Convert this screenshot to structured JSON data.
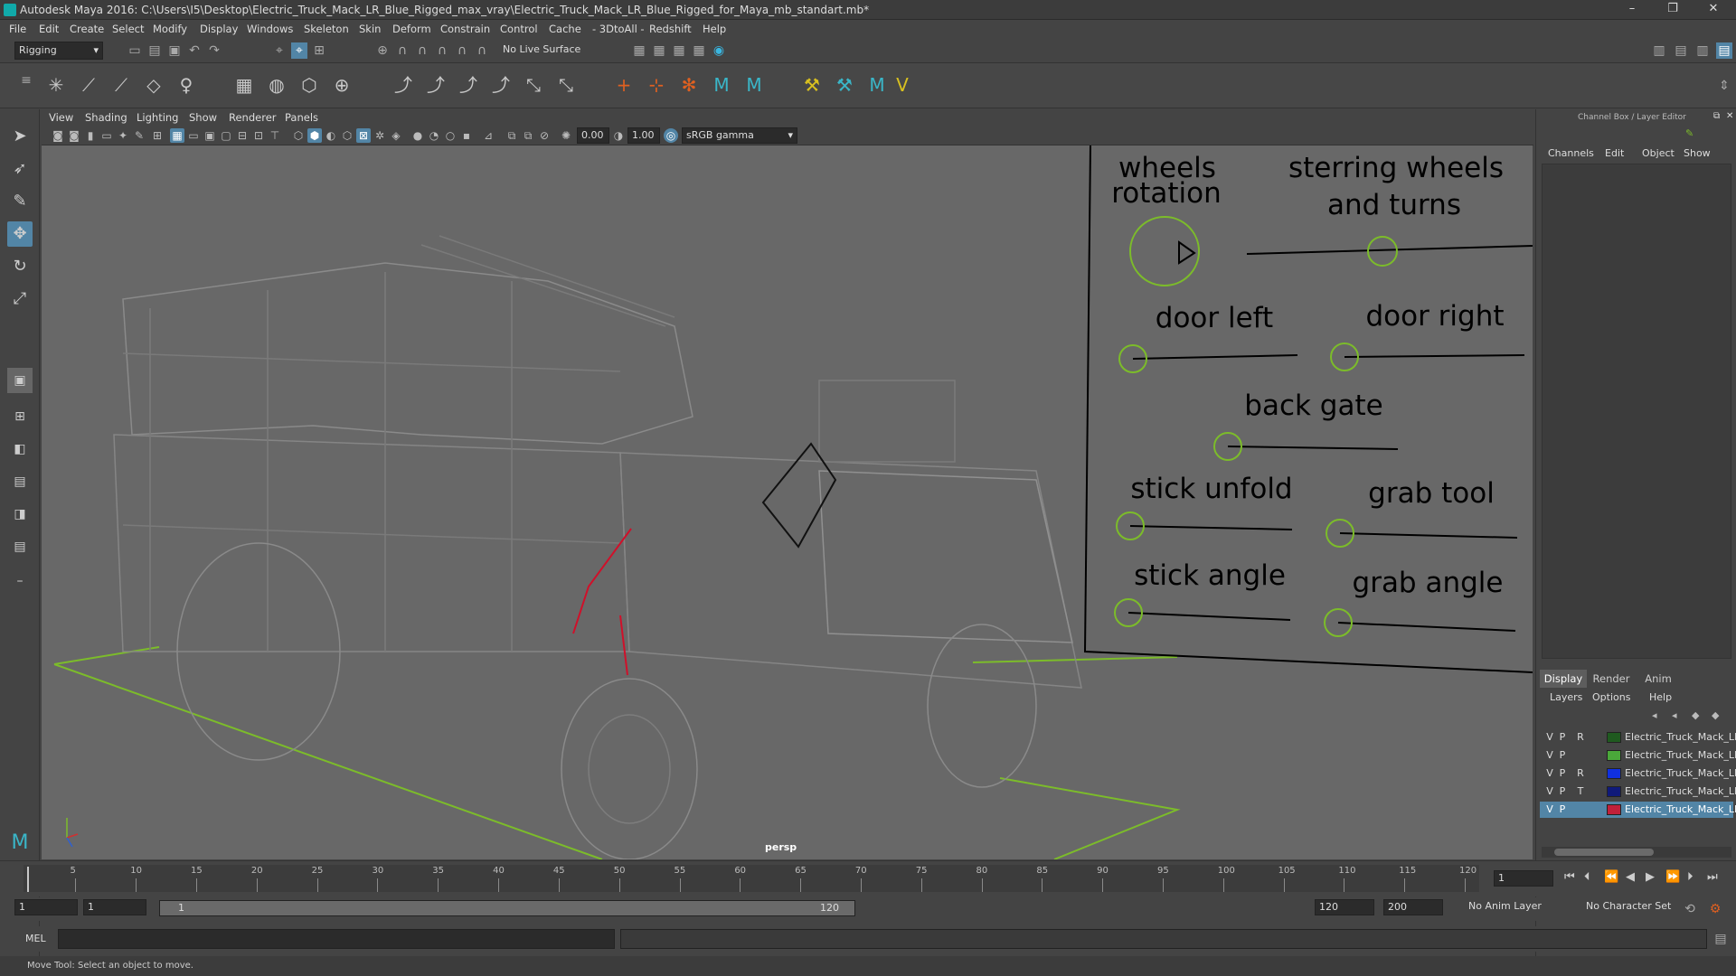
{
  "app": {
    "title": "Autodesk Maya 2016: C:\\Users\\I5\\Desktop\\Electric_Truck_Mack_LR_Blue_Rigged_max_vray\\Electric_Truck_Mack_LR_Blue_Rigged_for_Maya_mb_standart.mb*",
    "win_buttons": [
      "–",
      "❐",
      "✕"
    ]
  },
  "menus": [
    "File",
    "Edit",
    "Create",
    "Select",
    "Modify",
    "Display",
    "Windows",
    "Skeleton",
    "Skin",
    "Deform",
    "Constrain",
    "Control",
    "Cache",
    "- 3DtoAll -",
    "Redshift",
    "Help"
  ],
  "shelf": {
    "mode": "Rigging",
    "live_surface": "No Live Surface"
  },
  "viewport": {
    "menus": [
      "View",
      "Shading",
      "Lighting",
      "Show",
      "Renderer",
      "Panels"
    ],
    "near_value": "0.00",
    "far_value": "1.00",
    "color_space": "sRGB gamma",
    "camera_label": "persp",
    "controls": {
      "wheels_rotation_1": "wheels",
      "wheels_rotation_2": "rotation",
      "steering_1": "sterring wheels",
      "steering_2": "and turns",
      "door_left": "door left",
      "door_right": "door right",
      "back_gate": "back gate",
      "stick_unfold": "stick unfold",
      "grab_tool": "grab tool",
      "stick_angle": "stick angle",
      "grab_angle": "grab angle"
    }
  },
  "channel_box": {
    "title": "Channel Box / Layer Editor",
    "menus": [
      "Channels",
      "Edit",
      "Object",
      "Show"
    ]
  },
  "layer_editor": {
    "tabs": [
      "Display",
      "Render",
      "Anim"
    ],
    "active_tab": "Display",
    "menus": [
      "Layers",
      "Options",
      "Help"
    ],
    "layers": [
      {
        "v": "V",
        "p": "P",
        "r": "R",
        "color": "#1f5a1f",
        "name": "Electric_Truck_Mack_LR_Blue",
        "selected": false
      },
      {
        "v": "V",
        "p": "P",
        "r": "",
        "color": "#4aa83a",
        "name": "Electric_Truck_Mack_LR",
        "selected": false
      },
      {
        "v": "V",
        "p": "P",
        "r": "R",
        "color": "#1030e0",
        "name": "Electric_Truck_Mack_LR",
        "selected": false
      },
      {
        "v": "V",
        "p": "P",
        "r": "T",
        "color": "#101a7a",
        "name": "Electric_Truck_Mack_LR",
        "selected": false
      },
      {
        "v": "V",
        "p": "P",
        "r": "",
        "color": "#c0203a",
        "name": "Electric_Truck_Mack_LR",
        "selected": true
      }
    ]
  },
  "timeline": {
    "ticks": [
      1,
      5,
      10,
      15,
      20,
      25,
      30,
      35,
      40,
      45,
      50,
      55,
      60,
      65,
      70,
      75,
      80,
      85,
      90,
      95,
      100,
      105,
      110,
      115,
      120
    ],
    "current_frame": "1"
  },
  "range": {
    "start": "1",
    "start_inner": "1",
    "slider_start": "1",
    "slider_end": "120",
    "end": "120",
    "end_outer": "200",
    "anim_layer": "No Anim Layer",
    "character_set": "No Character Set"
  },
  "command": {
    "label": "MEL"
  },
  "help_line": "Move Tool: Select an object to move."
}
